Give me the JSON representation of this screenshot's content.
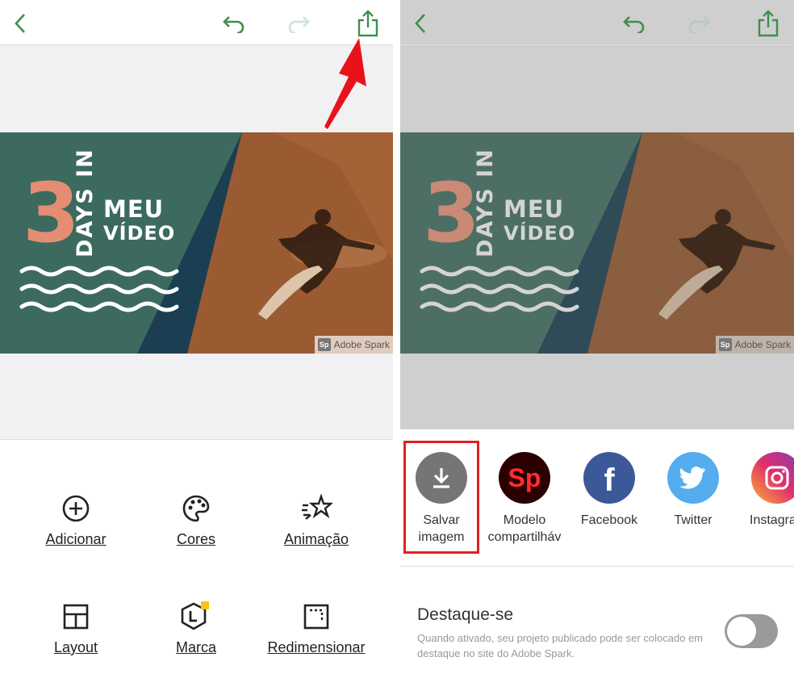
{
  "colors": {
    "accent": "#3f8f4a",
    "accent_disabled": "#cfe3d1",
    "banner_green": "#3c6a5e",
    "banner_navy": "#1c3e52",
    "banner_orange": "#9a5a32",
    "banner_number": "#e48d73",
    "highlight_red": "#e02020",
    "arrow_red": "#e9121b"
  },
  "left": {
    "toolbar": {
      "back_icon": "chevron-left-icon",
      "undo_icon": "undo-icon",
      "redo_icon": "redo-icon",
      "share_icon": "share-icon"
    },
    "banner": {
      "number": "3",
      "days_in": "DAYS IN",
      "title_line1": "MEU",
      "title_line2": "VÍDEO",
      "watermark": "Adobe Spark"
    },
    "tools": [
      {
        "label": "Adicionar",
        "icon": "plus-circle-icon"
      },
      {
        "label": "Cores",
        "icon": "palette-icon"
      },
      {
        "label": "Animação",
        "icon": "sparkle-star-icon"
      },
      {
        "label": "Layout",
        "icon": "grid-layout-icon"
      },
      {
        "label": "Marca",
        "icon": "brand-hexagon-icon"
      },
      {
        "label": "Redimensionar",
        "icon": "resize-icon"
      }
    ]
  },
  "right": {
    "banner": {
      "number": "3",
      "days_in": "DAYS IN",
      "title_line1": "MEU",
      "title_line2": "VÍDEO",
      "watermark": "Adobe Spark"
    },
    "share_options": [
      {
        "label_line1": "Salvar",
        "label_line2": "imagem",
        "icon": "download-icon"
      },
      {
        "label_line1": "Modelo",
        "label_line2": "compartilháv",
        "icon": "spark-post-logo-icon"
      },
      {
        "label_line1": "Facebook",
        "label_line2": "",
        "icon": "facebook-icon"
      },
      {
        "label_line1": "Twitter",
        "label_line2": "",
        "icon": "twitter-icon"
      },
      {
        "label_line1": "Instagra",
        "label_line2": "",
        "icon": "instagram-icon"
      }
    ],
    "feature": {
      "title": "Destaque-se",
      "description": "Quando ativado, seu projeto publicado pode ser colocado em destaque no site do Adobe Spark.",
      "toggle_on": false
    },
    "spark_logo_text": "Sp"
  }
}
